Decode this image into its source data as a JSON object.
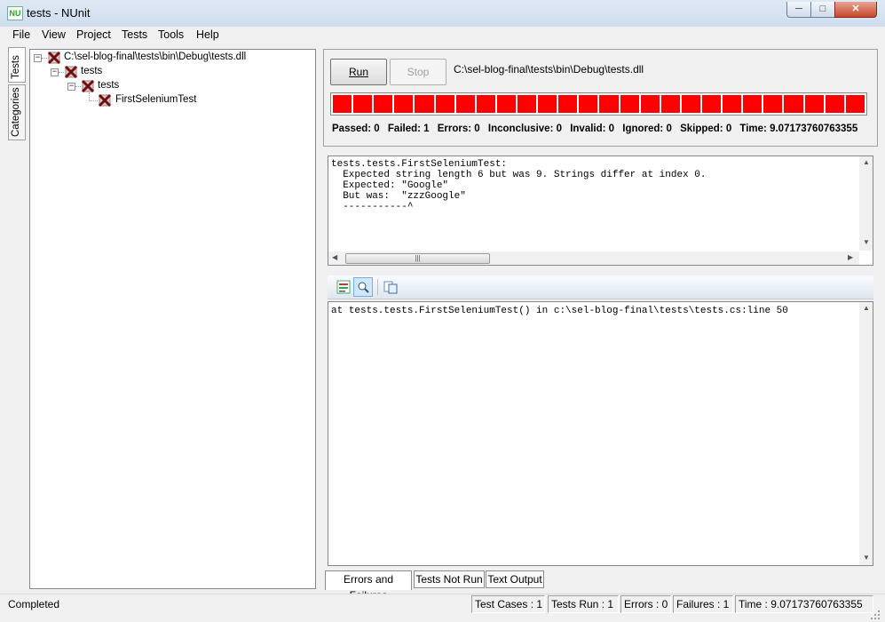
{
  "window": {
    "title": "tests - NUnit",
    "app_icon": "NU"
  },
  "menu": [
    "File",
    "View",
    "Project",
    "Tests",
    "Tools",
    "Help"
  ],
  "side_tabs": {
    "tests": "Tests",
    "categories": "Categories"
  },
  "tree": {
    "root": "C:\\sel-blog-final\\tests\\bin\\Debug\\tests.dll",
    "ns1": "tests",
    "ns2": "tests",
    "leaf": "FirstSeleniumTest"
  },
  "run_panel": {
    "run_label": "Run",
    "stop_label": "Stop",
    "assembly_path": "C:\\sel-blog-final\\tests\\bin\\Debug\\tests.dll",
    "progress_color": "#ff0000",
    "progress_fraction": 1.0
  },
  "stats": {
    "passed": "Passed: 0",
    "failed": "Failed: 1",
    "errors": "Errors: 0",
    "inconclusive": "Inconclusive: 0",
    "invalid": "Invalid: 0",
    "ignored": "Ignored: 0",
    "skipped": "Skipped: 0",
    "time": "Time: 9.07173760763355"
  },
  "error_message": "tests.tests.FirstSeleniumTest:\n  Expected string length 6 but was 9. Strings differ at index 0.\n  Expected: \"Google\"\n  But was:  \"zzzGoogle\"\n  -----------^",
  "stack_trace": "at tests.tests.FirstSeleniumTest() in c:\\sel-blog-final\\tests\\tests.cs:line 50",
  "result_tabs": [
    "Errors and Failures",
    "Tests Not Run",
    "Text Output"
  ],
  "status": {
    "text": "Completed",
    "test_cases": "Test Cases : 1",
    "tests_run": "Tests Run : 1",
    "errors": "Errors : 0",
    "failures": "Failures : 1",
    "time": "Time : 9.07173760763355"
  }
}
